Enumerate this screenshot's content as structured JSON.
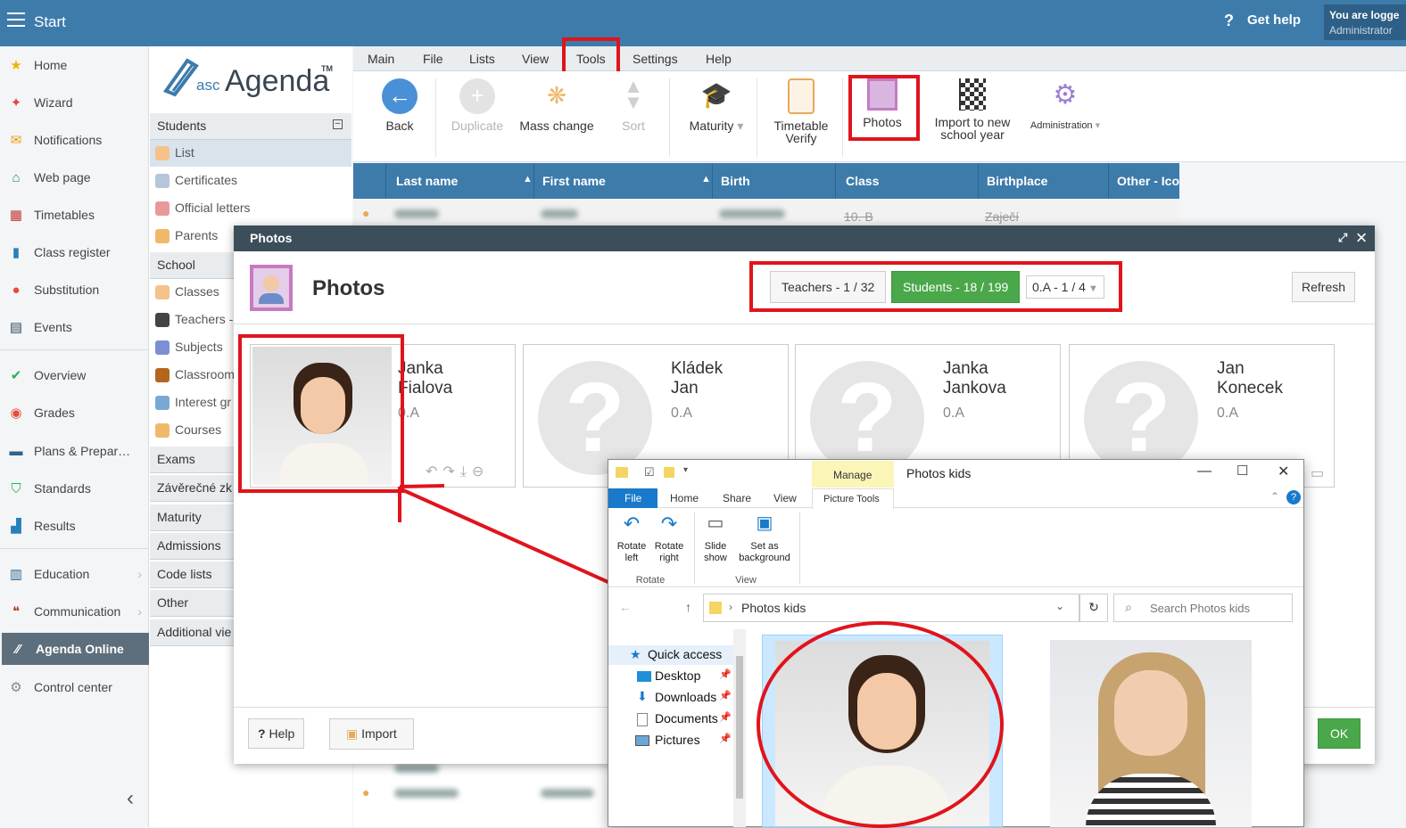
{
  "topbar": {
    "start": "Start",
    "get_help": "Get help",
    "user_line1": "You are logge",
    "user_line2": "Administrator"
  },
  "sidebar": {
    "items": [
      {
        "label": "Home",
        "icon": "star-icon"
      },
      {
        "label": "Wizard",
        "icon": "wand-icon"
      },
      {
        "label": "Notifications",
        "icon": "envelope-icon"
      },
      {
        "label": "Web page",
        "icon": "house-icon"
      },
      {
        "label": "Timetables",
        "icon": "grid-icon"
      },
      {
        "label": "Class register",
        "icon": "book-icon"
      },
      {
        "label": "Substitution",
        "icon": "person-icon"
      },
      {
        "label": "Events",
        "icon": "calendar-icon"
      },
      {
        "label": "Overview",
        "icon": "check-icon"
      },
      {
        "label": "Grades",
        "icon": "grades-icon"
      },
      {
        "label": "Plans & Prepar…",
        "icon": "briefcase-icon"
      },
      {
        "label": "Standards",
        "icon": "shield-icon"
      },
      {
        "label": "Results",
        "icon": "bar-chart-icon"
      },
      {
        "label": "Education",
        "icon": "education-icon"
      },
      {
        "label": "Communication",
        "icon": "chat-icon"
      },
      {
        "label": "Agenda Online",
        "icon": "agenda-icon"
      },
      {
        "label": "Control center",
        "icon": "gear-icon"
      }
    ]
  },
  "logo": {
    "pre": "asc",
    "main": "Agenda",
    "tm": "TM"
  },
  "subnav": {
    "students_header": "Students",
    "students_items": [
      "List",
      "Certificates",
      "Official letters",
      "Parents"
    ],
    "school_header": "School",
    "school_items": [
      "Classes",
      "Teachers -",
      "Subjects",
      "Classroom",
      "Interest gr",
      "Courses"
    ],
    "other_headers": [
      "Exams",
      "Závěrečné zk",
      "Maturity",
      "Admissions",
      "Code lists",
      "Other",
      "Additional vie"
    ]
  },
  "ribbon": {
    "tabs": [
      "Main",
      "File",
      "Lists",
      "View",
      "Tools",
      "Settings",
      "Help"
    ],
    "buttons": {
      "back": "Back",
      "duplicate": "Duplicate",
      "mass_change": "Mass change",
      "sort": "Sort",
      "maturity": "Maturity",
      "timetable_1": "Timetable",
      "timetable_2": "Verify",
      "photos": "Photos",
      "import_1": "Import to new",
      "import_2": "school year",
      "administration": "Administration"
    }
  },
  "grid": {
    "headers": [
      "Last name",
      "First name",
      "Birth",
      "Class",
      "Birthplace",
      "Other - Ico"
    ],
    "row1": {
      "class": "10. B",
      "birthplace": "Zaječí"
    }
  },
  "dialog": {
    "title": "Photos",
    "heading": "Photos",
    "teachers_btn": "Teachers - 1 / 32",
    "students_btn": "Students - 18 / 199",
    "class_select": "0.A - 1 / 4",
    "refresh": "Refresh",
    "help": "Help",
    "import": "Import",
    "ok": "OK",
    "cards": [
      {
        "first": "Janka",
        "last": "Fialova",
        "class": "0.A"
      },
      {
        "first": "Kládek",
        "last": "Jan",
        "class": "0.A"
      },
      {
        "first": "Janka",
        "last": "Jankova",
        "class": "0.A"
      },
      {
        "first": "Jan",
        "last": "Konecek",
        "class": "0.A"
      }
    ]
  },
  "explorer": {
    "title": "Photos kids",
    "manage": "Manage",
    "tabs": [
      "File",
      "Home",
      "Share",
      "View",
      "Picture Tools"
    ],
    "rotate_left_1": "Rotate",
    "rotate_left_2": "left",
    "rotate_right_1": "Rotate",
    "rotate_right_2": "right",
    "slide_1": "Slide",
    "slide_2": "show",
    "setbg_1": "Set as",
    "setbg_2": "background",
    "group_rotate": "Rotate",
    "group_view": "View",
    "path": "Photos kids",
    "search_placeholder": "Search Photos kids",
    "nav": [
      "Quick access",
      "Desktop",
      "Downloads",
      "Documents",
      "Pictures"
    ]
  },
  "colors": {
    "accent": "#3d7bab",
    "highlight": "#e0141c",
    "green": "#4aa84a"
  }
}
